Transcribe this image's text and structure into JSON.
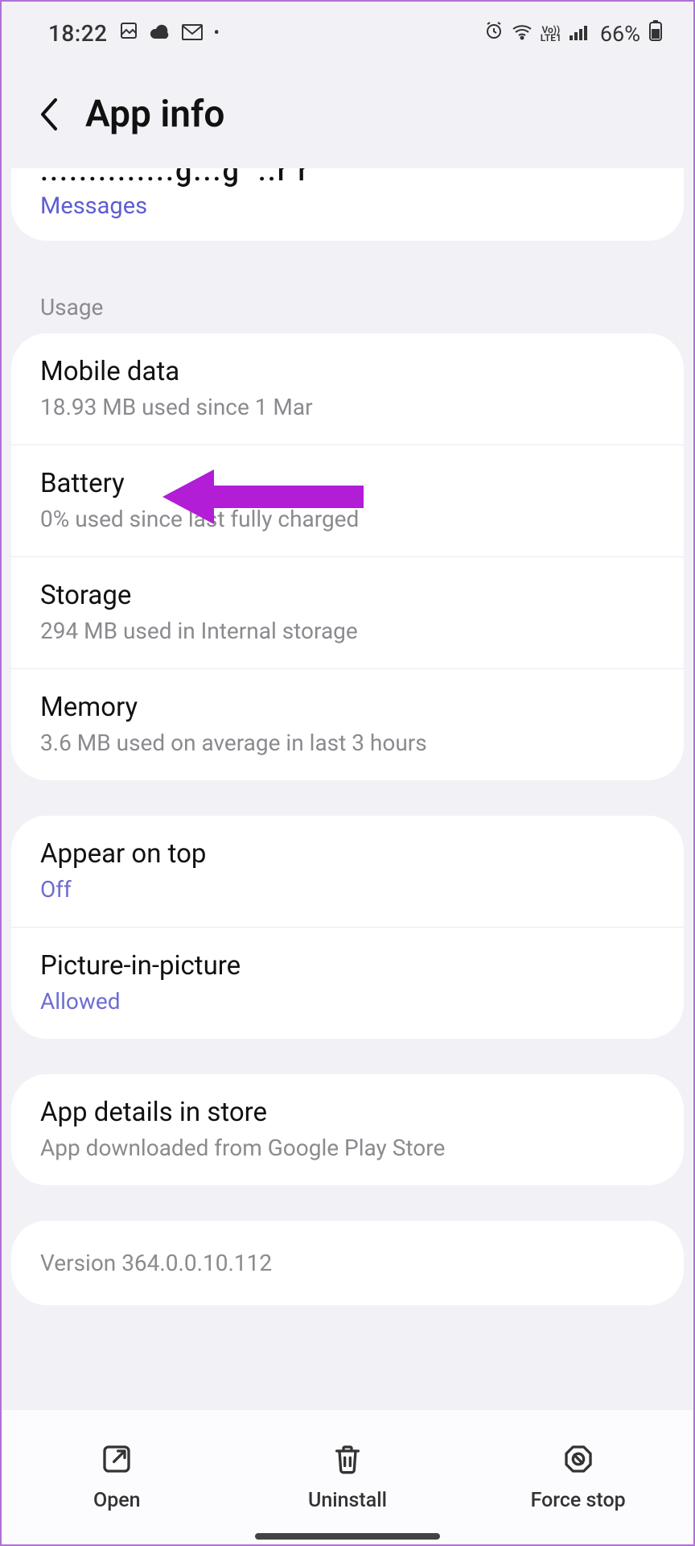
{
  "statusbar": {
    "time": "18:22",
    "battery_pct": "66%",
    "lte_label": "Vo))\nLTE1"
  },
  "header": {
    "title": "App info"
  },
  "truncated_row": {
    "title_fragment": "...........g...g  ..pp",
    "sub": "Messages"
  },
  "section_usage": "Usage",
  "usage": {
    "mobile_data": {
      "title": "Mobile data",
      "sub": "18.93 MB used since 1 Mar"
    },
    "battery": {
      "title": "Battery",
      "sub": "0% used since last fully charged"
    },
    "storage": {
      "title": "Storage",
      "sub": "294 MB used in Internal storage"
    },
    "memory": {
      "title": "Memory",
      "sub": "3.6 MB used on average in last 3 hours"
    }
  },
  "advanced": {
    "appear_on_top": {
      "title": "Appear on top",
      "value": "Off"
    },
    "pip": {
      "title": "Picture-in-picture",
      "value": "Allowed"
    }
  },
  "store": {
    "title": "App details in store",
    "sub": "App downloaded from Google Play Store"
  },
  "version": "Version 364.0.0.10.112",
  "bottom": {
    "open": "Open",
    "uninstall": "Uninstall",
    "force_stop": "Force stop"
  },
  "annotation": {
    "arrow_color": "#b21dd6",
    "arrow_target": "battery"
  }
}
